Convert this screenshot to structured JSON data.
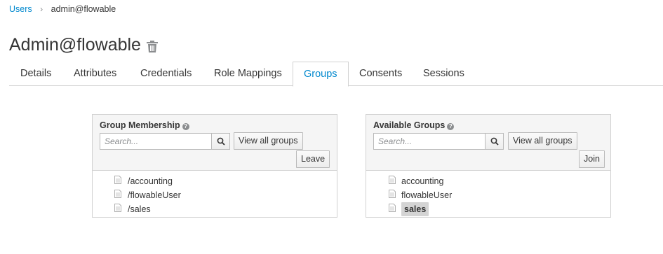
{
  "breadcrumb": {
    "root": "Users",
    "separator": "›",
    "current": "admin@flowable"
  },
  "page": {
    "title": "Admin@flowable"
  },
  "tabs": [
    {
      "label": "Details"
    },
    {
      "label": "Attributes"
    },
    {
      "label": "Credentials"
    },
    {
      "label": "Role Mappings"
    },
    {
      "label": "Groups",
      "active": true
    },
    {
      "label": "Consents"
    },
    {
      "label": "Sessions"
    }
  ],
  "membership": {
    "title": "Group Membership",
    "search_placeholder": "Search...",
    "view_all_label": "View all groups",
    "action_label": "Leave",
    "items": [
      "/accounting",
      "/flowableUser",
      "/sales"
    ]
  },
  "available": {
    "title": "Available Groups",
    "search_placeholder": "Search...",
    "view_all_label": "View all groups",
    "action_label": "Join",
    "items": [
      "accounting",
      "flowableUser",
      "sales"
    ],
    "selected": "sales"
  },
  "colors": {
    "link": "#0088ce",
    "panel_header": "#f5f5f5",
    "border": "#d1d1d1"
  }
}
